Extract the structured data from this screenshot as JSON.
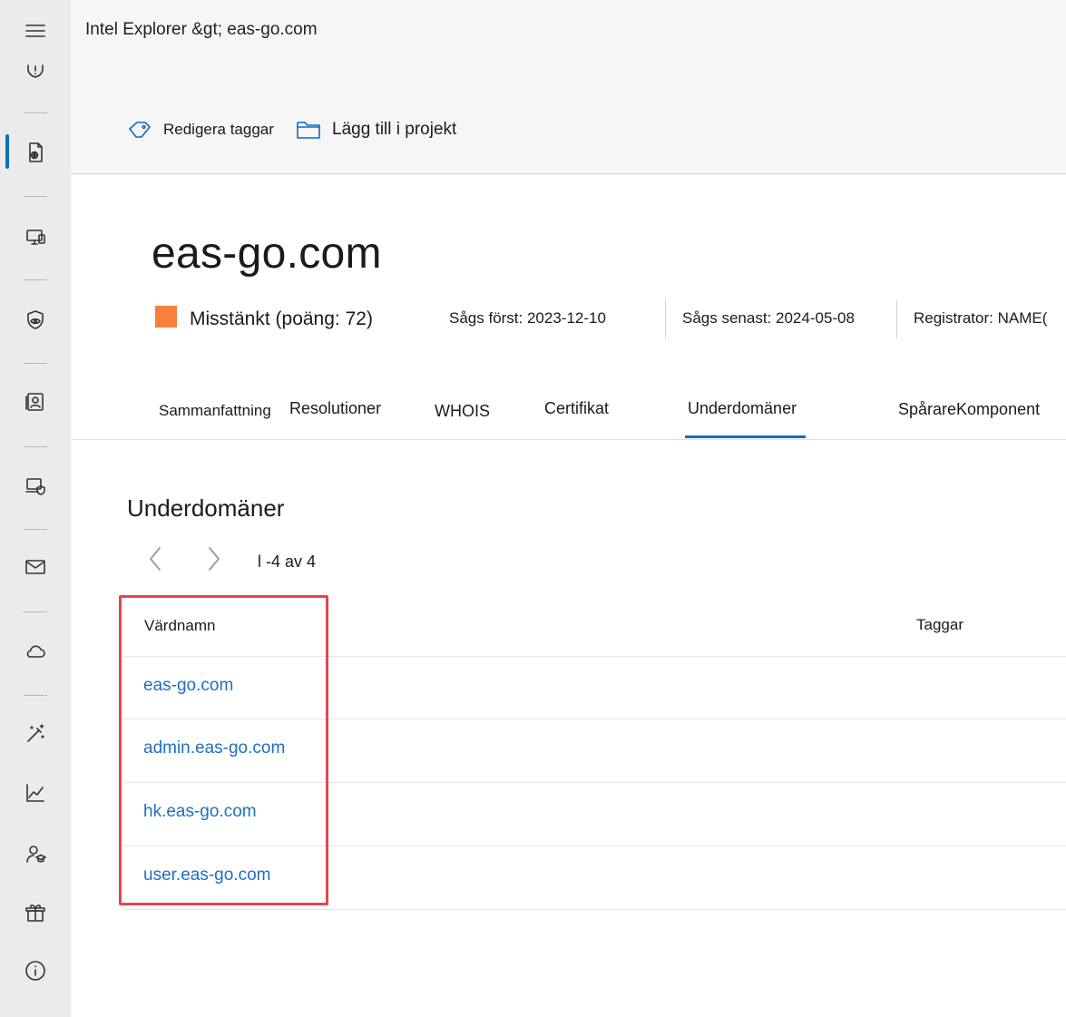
{
  "breadcrumb": "Intel Explorer &gt; eas-go.com",
  "commands": {
    "edit_tags": "Redigera taggar",
    "add_to_project": "Lägg till i projekt"
  },
  "artifact": {
    "title": "eas-go.com",
    "severity_label": "Misstänkt",
    "severity_score": "(poäng: 72)",
    "first_seen": "Sågs först: 2023-12-10",
    "last_seen": "Sågs senast: 2024-05-08",
    "registrar": "Registrator: NAME("
  },
  "tabs": [
    "Sammanfattning",
    "Resolutioner",
    "WHOIS",
    "Certifikat",
    "Underdomäner",
    "SpårareKomponent"
  ],
  "active_tab": "Underdomäner",
  "section": {
    "title": "Underdomäner",
    "pager": "l -4 av 4"
  },
  "table": {
    "columns": [
      "Värdnamn",
      "Taggar"
    ],
    "rows": [
      {
        "hostname": "eas-go.com"
      },
      {
        "hostname": "admin.eas-go.com"
      },
      {
        "hostname": "hk.eas-go.com"
      },
      {
        "hostname": "user.eas-go.com"
      }
    ]
  },
  "colors": {
    "accent": "#0f6cbd",
    "link": "#1f6fc0",
    "severity": "#f7803c",
    "highlight": "#e0474c"
  }
}
